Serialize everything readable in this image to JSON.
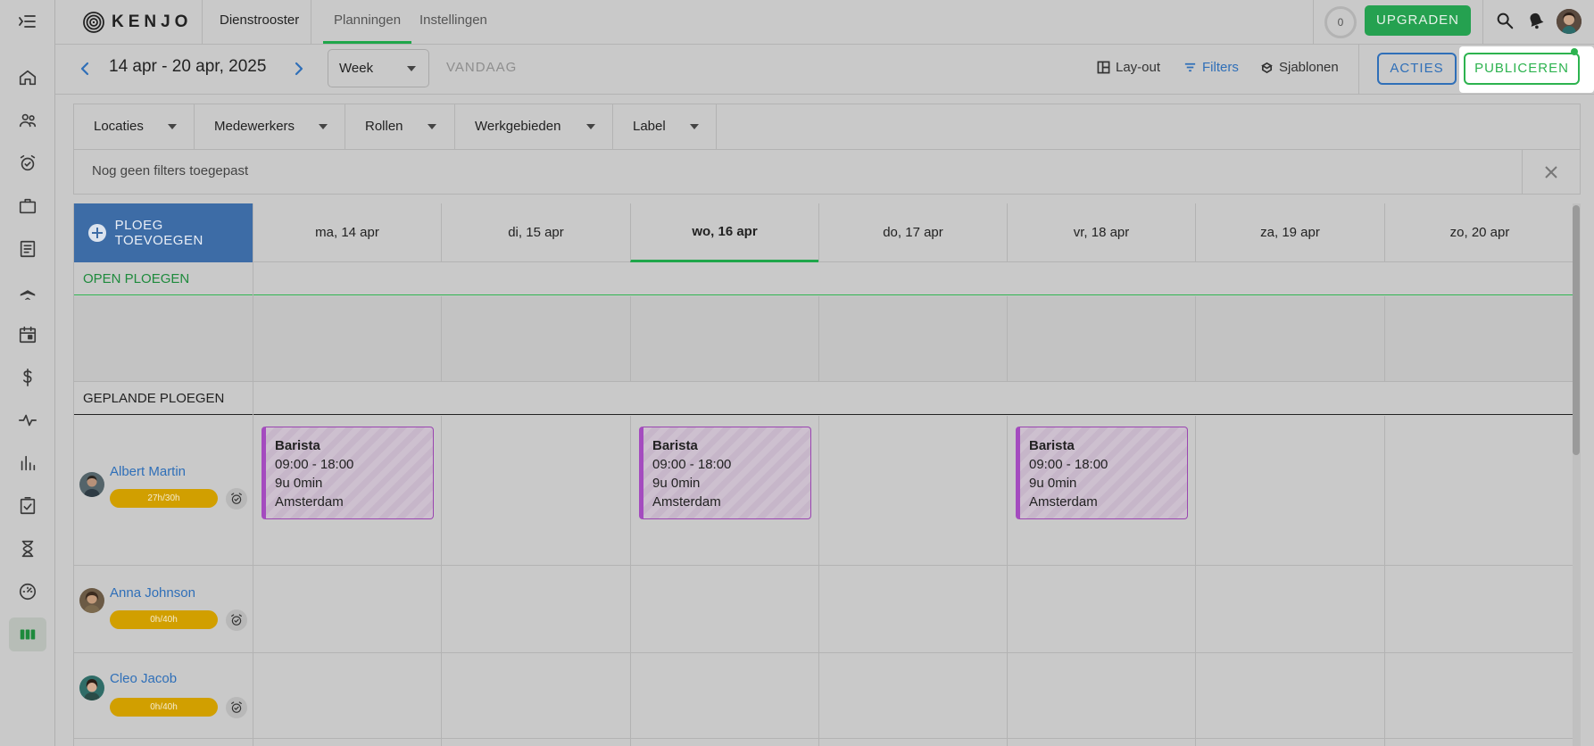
{
  "sidebar": {
    "items": [
      {
        "icon": "home-icon"
      },
      {
        "icon": "people-icon"
      },
      {
        "icon": "alarm-clock-icon"
      },
      {
        "icon": "briefcase-icon"
      },
      {
        "icon": "document-icon"
      },
      {
        "icon": "airplane-icon"
      },
      {
        "icon": "calendar-icon"
      },
      {
        "icon": "dollar-icon"
      },
      {
        "icon": "pulse-icon"
      },
      {
        "icon": "bar-chart-icon"
      },
      {
        "icon": "checklist-icon"
      },
      {
        "icon": "hourglass-icon"
      },
      {
        "icon": "speedometer-icon"
      },
      {
        "icon": "shift-planning-icon",
        "active": true
      }
    ]
  },
  "header": {
    "logo": "KENJO",
    "app_title": "Dienstrooster",
    "tabs": [
      {
        "label": "Planningen",
        "active": true
      },
      {
        "label": "Instellingen",
        "active": false
      }
    ],
    "counter": "0",
    "upgrade_label": "UPGRADEN"
  },
  "toolbar": {
    "date_range": "14 apr - 20 apr, 2025",
    "view_select": "Week",
    "today_label": "VANDAAG",
    "layout_label": "Lay-out",
    "filters_label": "Filters",
    "templates_label": "Sjablonen",
    "actions_label": "ACTIES",
    "publish_label": "PUBLICEREN"
  },
  "filters": {
    "dropdowns": [
      "Locaties",
      "Medewerkers",
      "Rollen",
      "Werkgebieden",
      "Label"
    ],
    "status_text": "Nog geen filters toegepast"
  },
  "schedule": {
    "add_team_label": "PLOEG TOEVOEGEN",
    "days": [
      "ma, 14 apr",
      "di, 15 apr",
      "wo, 16 apr",
      "do, 17 apr",
      "vr, 18 apr",
      "za, 19 apr",
      "zo, 20 apr"
    ],
    "today_day": "wo, 16 apr",
    "open_section": "OPEN PLOEGEN",
    "planned_section": "GEPLANDE PLOEGEN",
    "employees": [
      {
        "name": "Albert Martin",
        "hours": "27h/30h"
      },
      {
        "name": "Anna Johnson",
        "hours": "0h/40h"
      },
      {
        "name": "Cleo Jacob",
        "hours": "0h/40h"
      }
    ],
    "shifts": [
      {
        "day": "ma, 14 apr",
        "role": "Barista",
        "time": "09:00 - 18:00",
        "duration": "9u 0min",
        "location": "Amsterdam"
      },
      {
        "day": "wo, 16 apr",
        "role": "Barista",
        "time": "09:00 - 18:00",
        "duration": "9u 0min",
        "location": "Amsterdam"
      },
      {
        "day": "vr, 18 apr",
        "role": "Barista",
        "time": "09:00 - 18:00",
        "duration": "9u 0min",
        "location": "Amsterdam"
      }
    ]
  },
  "colors": {
    "brand_green": "#1fa64a",
    "accent_blue": "#2f6fb8",
    "add_team_blue": "#3d6ca6",
    "hours_pill": "#d19f00",
    "shift_purple": "#a44bbf"
  }
}
